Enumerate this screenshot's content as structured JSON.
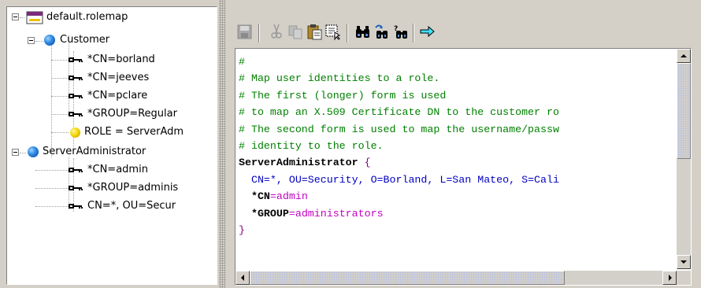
{
  "tree": {
    "root": {
      "label": "default.rolemap",
      "icon": "rolemap-file-icon"
    },
    "roles": [
      {
        "label": "Customer",
        "icon": "role-globe-icon",
        "children": [
          {
            "label": "*CN=borland",
            "icon": "key-icon"
          },
          {
            "label": "*CN=jeeves",
            "icon": "key-icon"
          },
          {
            "label": "*CN=pclare",
            "icon": "key-icon"
          },
          {
            "label": "*GROUP=Regular",
            "icon": "key-icon"
          },
          {
            "label": "ROLE = ServerAdm",
            "icon": "role-reference-icon"
          }
        ]
      },
      {
        "label": "ServerAdministrator",
        "icon": "role-globe-icon",
        "children": [
          {
            "label": "*CN=admin",
            "icon": "key-icon"
          },
          {
            "label": "*GROUP=adminis",
            "icon": "key-icon"
          },
          {
            "label": "CN=*, OU=Secur",
            "icon": "key-icon"
          }
        ]
      }
    ]
  },
  "toolbar": {
    "buttons": [
      {
        "name": "save-icon",
        "enabled": false
      },
      {
        "name": "cut-icon",
        "enabled": false
      },
      {
        "name": "copy-icon",
        "enabled": false
      },
      {
        "name": "paste-icon",
        "enabled": true
      },
      {
        "name": "select-all-icon",
        "enabled": true
      },
      {
        "name": "find-icon",
        "enabled": true
      },
      {
        "name": "find-again-icon",
        "enabled": true
      },
      {
        "name": "replace-icon",
        "enabled": true
      },
      {
        "name": "goto-line-icon",
        "enabled": true
      }
    ]
  },
  "editor": {
    "lines": [
      [
        {
          "t": "comment",
          "v": "#"
        }
      ],
      [
        {
          "t": "comment",
          "v": "# Map user identities to a role."
        }
      ],
      [
        {
          "t": "comment",
          "v": "# The first (longer) form is used"
        }
      ],
      [
        {
          "t": "comment",
          "v": "# to map an X.509 Certificate DN to the customer ro"
        }
      ],
      [
        {
          "t": "comment",
          "v": "# The second form is used to map the username/passw"
        }
      ],
      [
        {
          "t": "comment",
          "v": "# identity to the role."
        }
      ],
      [
        {
          "t": "ident",
          "v": "ServerAdministrator"
        },
        {
          "t": "brace",
          "v": " {"
        }
      ],
      [
        {
          "t": "assign",
          "v": "  CN=*, OU=Security, O=Borland, L=San Mateo, S=Cali"
        }
      ],
      [
        {
          "t": "plain",
          "v": "  "
        },
        {
          "t": "keyword",
          "v": "*CN"
        },
        {
          "t": "eq",
          "v": "="
        },
        {
          "t": "value",
          "v": "admin"
        }
      ],
      [
        {
          "t": "plain",
          "v": "  "
        },
        {
          "t": "keyword",
          "v": "*GROUP"
        },
        {
          "t": "eq",
          "v": "="
        },
        {
          "t": "value",
          "v": "administrators"
        }
      ],
      [
        {
          "t": "brace",
          "v": "}"
        }
      ]
    ]
  },
  "colors": {
    "comment": "#008000",
    "ident": "#000000",
    "brace": "#7f007f",
    "assign": "#0000c0",
    "value": "#c000c0",
    "background": "#d4d0c8"
  }
}
